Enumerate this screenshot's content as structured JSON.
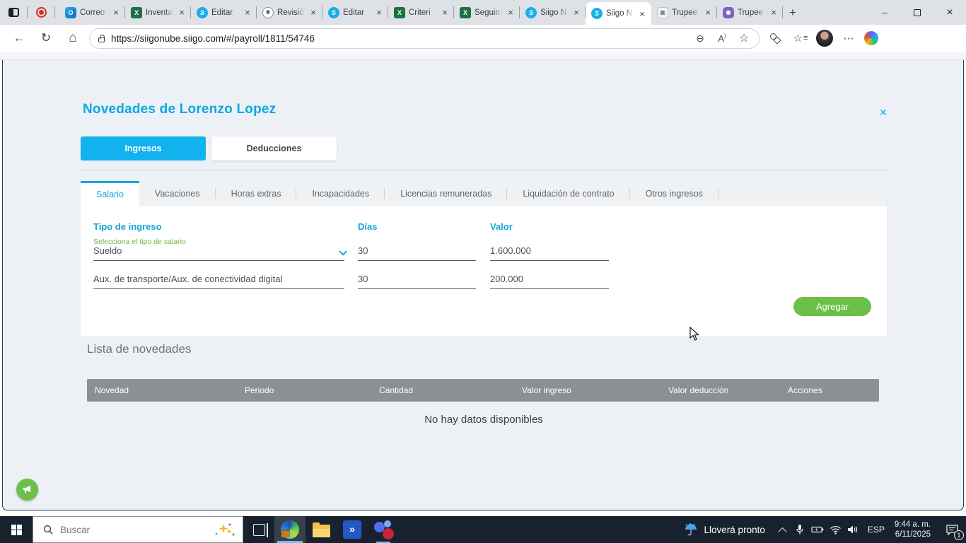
{
  "colors": {
    "accent_blue": "#12b2ef",
    "title_blue": "#0aa9e2",
    "button_green": "#6cc04a",
    "helper_green": "#7cb342",
    "table_header_gray": "#8d9093"
  },
  "browser": {
    "url": "https://siigonube.siigo.com/#/payroll/1811/54746",
    "tabs": [
      {
        "title": "Correo",
        "icon": "outlook"
      },
      {
        "title": "Inventa",
        "icon": "excel"
      },
      {
        "title": "Editar",
        "icon": "siigo"
      },
      {
        "title": "Revisió",
        "icon": "chatgpt"
      },
      {
        "title": "Editar",
        "icon": "siigo"
      },
      {
        "title": "Criteri",
        "icon": "excel"
      },
      {
        "title": "Seguim",
        "icon": "excel"
      },
      {
        "title": "Siigo N",
        "icon": "siigo"
      },
      {
        "title": "Siigo N",
        "icon": "siigo"
      },
      {
        "title": "Trupee",
        "icon": "trupee-light"
      },
      {
        "title": "Trupee",
        "icon": "trupee-purple"
      }
    ]
  },
  "page": {
    "title": "Novedades de Lorenzo Lopez",
    "primary_tabs": {
      "ingresos": "Ingresos",
      "deducciones": "Deducciones"
    },
    "subtabs": [
      "Salario",
      "Vacaciones",
      "Horas extras",
      "Incapacidades",
      "Licencias remuneradas",
      "Liquidación de contrato",
      "Otros ingresos"
    ],
    "form": {
      "col_tipo": "Tipo de ingreso",
      "col_dias": "Días",
      "col_valor": "Valor",
      "helper": "Selecciona el tipo de salario",
      "rows": [
        {
          "tipo": "Sueldo",
          "dias": "30",
          "valor": "1.600.000"
        },
        {
          "tipo": "Aux. de transporte/Aux. de conectividad digital",
          "dias": "30",
          "valor": "200.000"
        }
      ],
      "submit": "Agregar"
    },
    "list": {
      "heading": "Lista de novedades",
      "columns": [
        "Novedad",
        "Periodo",
        "Cantidad",
        "Valor ingreso",
        "Valor deducción",
        "Acciones"
      ],
      "empty": "No hay datos disponibles"
    }
  },
  "taskbar": {
    "search_placeholder": "Buscar",
    "weather": "Lloverá pronto",
    "language": "ESP",
    "time": "9:44 a. m.",
    "date": "6/11/2025",
    "notification_count": "1"
  }
}
